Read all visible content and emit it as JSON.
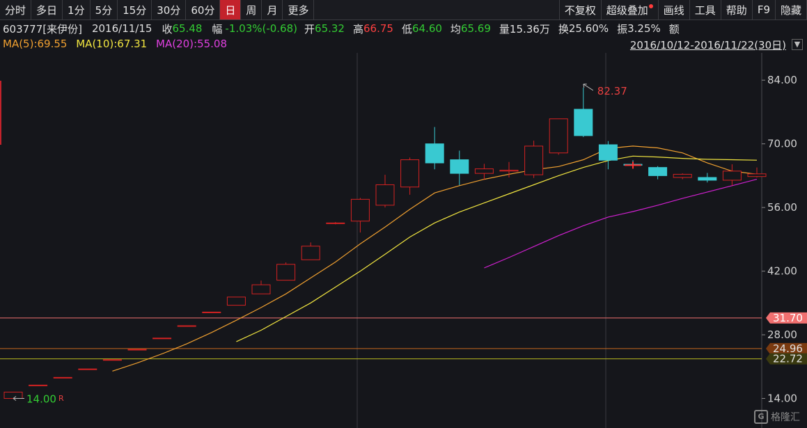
{
  "toolbar": {
    "periods": [
      "分时",
      "多日",
      "1分",
      "5分",
      "15分",
      "30分",
      "60分",
      "日",
      "周",
      "月",
      "更多"
    ],
    "active_period": "日",
    "right_buttons": [
      "不复权",
      "超级叠加",
      "画线",
      "工具",
      "帮助",
      "F9",
      "隐藏"
    ]
  },
  "info": {
    "code": "603777[来伊份]",
    "date": "2016/11/15",
    "close_label": "收",
    "close_value": "65.48",
    "change_label": "幅",
    "change_value": "-1.03%(-0.68)",
    "open_label": "开",
    "open_value": "65.32",
    "high_label": "高",
    "high_value": "66.75",
    "low_label": "低",
    "low_value": "64.60",
    "avg_label": "均",
    "avg_value": "65.69",
    "volume_label": "量",
    "volume_value": "15.36万",
    "turnover_label": "换",
    "turnover_value": "25.60%",
    "amplitude_label": "振",
    "amplitude_value": "3.25%",
    "amount_label": "额"
  },
  "ma": {
    "ma5": "MA(5):69.55",
    "ma10": "MA(10):67.31",
    "ma20": "MA(20):55.08"
  },
  "date_range": "2016/10/12-2016/11/22(30日)",
  "colors": {
    "up": "#d42222",
    "down": "#39c9d1",
    "ma5": "#f0a030",
    "ma10": "#f2e640",
    "ma20": "#d020d0",
    "hline1": "#f07070",
    "hline2": "#c86a1e",
    "hline3": "#b8b820"
  },
  "watermark": "格隆汇",
  "chart_data": {
    "type": "candlestick",
    "ylim": [
      7.5,
      90
    ],
    "y_ticks": [
      "84.00",
      "70.00",
      "56.00",
      "42.00",
      "28.00",
      "14.00"
    ],
    "y_tick_values": [
      84,
      70,
      56,
      42,
      28,
      14
    ],
    "candles": [
      {
        "o": 14.0,
        "h": 15.4,
        "l": 14.0,
        "c": 15.4
      },
      {
        "o": 16.9,
        "h": 16.94,
        "l": 16.9,
        "c": 16.94
      },
      {
        "o": 18.63,
        "h": 18.63,
        "l": 18.63,
        "c": 18.63
      },
      {
        "o": 20.49,
        "h": 20.49,
        "l": 20.49,
        "c": 20.49
      },
      {
        "o": 22.54,
        "h": 22.54,
        "l": 22.54,
        "c": 22.54
      },
      {
        "o": 24.8,
        "h": 24.8,
        "l": 24.8,
        "c": 24.8
      },
      {
        "o": 27.28,
        "h": 27.28,
        "l": 27.28,
        "c": 27.28
      },
      {
        "o": 30.0,
        "h": 30.0,
        "l": 30.0,
        "c": 30.0
      },
      {
        "o": 33.0,
        "h": 33.0,
        "l": 33.0,
        "c": 33.0
      },
      {
        "o": 34.5,
        "h": 36.3,
        "l": 34.5,
        "c": 36.3
      },
      {
        "o": 37.0,
        "h": 39.93,
        "l": 37.0,
        "c": 39.0
      },
      {
        "o": 40.0,
        "h": 43.92,
        "l": 40.0,
        "c": 43.5
      },
      {
        "o": 44.5,
        "h": 48.31,
        "l": 44.5,
        "c": 47.5
      },
      {
        "o": 52.5,
        "h": 52.8,
        "l": 52.3,
        "c": 52.6
      },
      {
        "o": 53.0,
        "h": 58.1,
        "l": 50.5,
        "c": 57.8
      },
      {
        "o": 56.5,
        "h": 63.2,
        "l": 56.0,
        "c": 61.0
      },
      {
        "o": 60.5,
        "h": 66.98,
        "l": 58.8,
        "c": 66.5
      },
      {
        "o": 70.0,
        "h": 73.7,
        "l": 64.4,
        "c": 65.8
      },
      {
        "o": 66.5,
        "h": 68.5,
        "l": 60.9,
        "c": 63.5
      },
      {
        "o": 63.5,
        "h": 65.6,
        "l": 62.1,
        "c": 64.5
      },
      {
        "o": 64.0,
        "h": 66.0,
        "l": 62.6,
        "c": 64.2
      },
      {
        "o": 63.2,
        "h": 70.7,
        "l": 62.5,
        "c": 69.5
      },
      {
        "o": 68.0,
        "h": 75.5,
        "l": 67.6,
        "c": 75.5
      },
      {
        "o": 77.6,
        "h": 82.37,
        "l": 71.5,
        "c": 71.8
      },
      {
        "o": 69.8,
        "h": 70.6,
        "l": 64.4,
        "c": 66.4
      },
      {
        "o": 65.5,
        "h": 66.4,
        "l": 64.6,
        "c": 65.3
      },
      {
        "o": 64.8,
        "h": 65.1,
        "l": 62.2,
        "c": 63.0
      },
      {
        "o": 62.6,
        "h": 63.5,
        "l": 62.2,
        "c": 63.3
      },
      {
        "o": 62.6,
        "h": 63.6,
        "l": 61.5,
        "c": 62.0
      },
      {
        "o": 62.0,
        "h": 65.5,
        "l": 60.8,
        "c": 64.0
      },
      {
        "o": 62.8,
        "h": 64.8,
        "l": 62.6,
        "c": 63.4
      }
    ],
    "ma5_line": [
      null,
      null,
      null,
      null,
      20.0,
      21.8,
      23.8,
      26.0,
      28.5,
      31.2,
      34.0,
      37.0,
      40.5,
      44.0,
      48.0,
      51.7,
      55.6,
      59.2,
      60.8,
      62.2,
      63.3,
      64.3,
      65.0,
      66.5,
      69.0,
      69.5,
      69.1,
      68.0,
      65.8,
      64.0,
      63.3
    ],
    "ma10_line": [
      null,
      null,
      null,
      null,
      null,
      null,
      null,
      null,
      null,
      26.5,
      29.0,
      32.0,
      35.0,
      38.5,
      42.0,
      45.7,
      49.5,
      52.6,
      55.0,
      57.0,
      59.0,
      61.0,
      63.0,
      64.8,
      66.3,
      67.3,
      67.1,
      66.8,
      66.6,
      66.5,
      66.4
    ],
    "ma20_line": [
      null,
      null,
      null,
      null,
      null,
      null,
      null,
      null,
      null,
      null,
      null,
      null,
      null,
      null,
      null,
      null,
      null,
      null,
      null,
      42.7,
      45.0,
      47.4,
      49.8,
      52.0,
      53.9,
      55.1,
      56.5,
      58.0,
      59.4,
      60.8,
      62.2
    ],
    "annotations": [
      {
        "index": 23,
        "value": 82.37,
        "text": "82.37",
        "color": "#e84040"
      },
      {
        "index": 0,
        "value": 14.0,
        "text": "14.00",
        "color": "#33cc33"
      }
    ],
    "h_lines": [
      {
        "value": 31.7,
        "text": "31.70",
        "color": "#f07070",
        "label_bg": "#f07070",
        "label_fg": "#ffffff"
      },
      {
        "value": 24.96,
        "text": "24.96",
        "color": "#c86a1e",
        "label_bg": "#7a3a10",
        "label_fg": "#e0e0e0"
      },
      {
        "value": 22.72,
        "text": "22.72",
        "color": "#b8b820",
        "label_bg": "#3a3a10",
        "label_fg": "#e0e0e0"
      }
    ],
    "r_marker": "R"
  }
}
